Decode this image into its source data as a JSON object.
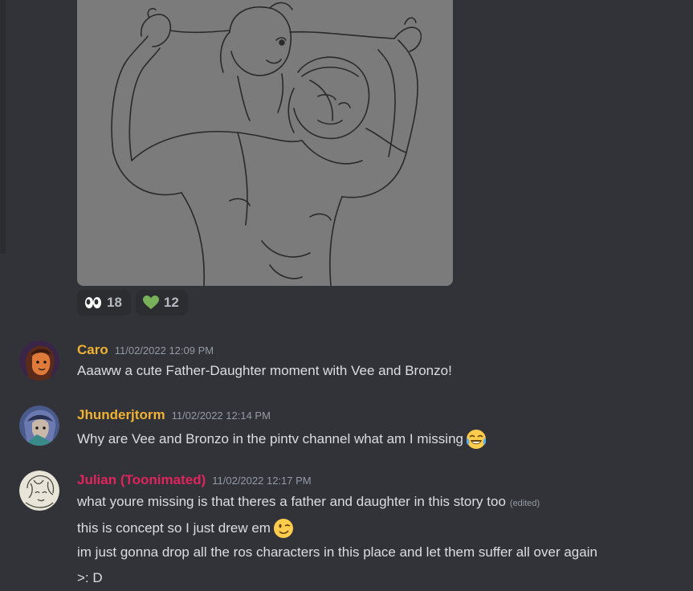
{
  "attachment": {
    "description_icon": "sketch-image"
  },
  "reactions": [
    {
      "emoji": "eyes-emoji",
      "count": "18"
    },
    {
      "emoji": "green-heart-emoji",
      "count": "12"
    }
  ],
  "messages": [
    {
      "username": "Caro",
      "username_color": "#f0b232",
      "timestamp": "11/02/2022 12:09 PM",
      "lines": [
        {
          "text": "Aaaww a cute Father-Daughter moment with Vee and Bronzo!"
        }
      ]
    },
    {
      "username": "Jhunderjtorm",
      "username_color": "#f0b232",
      "timestamp": "11/02/2022 12:14 PM",
      "lines": [
        {
          "text": "Why are Vee and Bronzo in the pintv channel what am I missing",
          "emoji": "joy-emoji"
        }
      ]
    },
    {
      "username": "Julian (Toonimated)",
      "username_color": "#e0245e",
      "timestamp": "11/02/2022 12:17 PM",
      "lines": [
        {
          "text": "what youre missing is that theres a father and daughter in this story too",
          "edited": "(edited)"
        },
        {
          "text": "this is concept so I just drew em",
          "emoji": "wink-emoji"
        },
        {
          "text": "im just gonna drop all the ros characters in this place and let them suffer all over again"
        },
        {
          "text": ">: D"
        }
      ]
    }
  ]
}
